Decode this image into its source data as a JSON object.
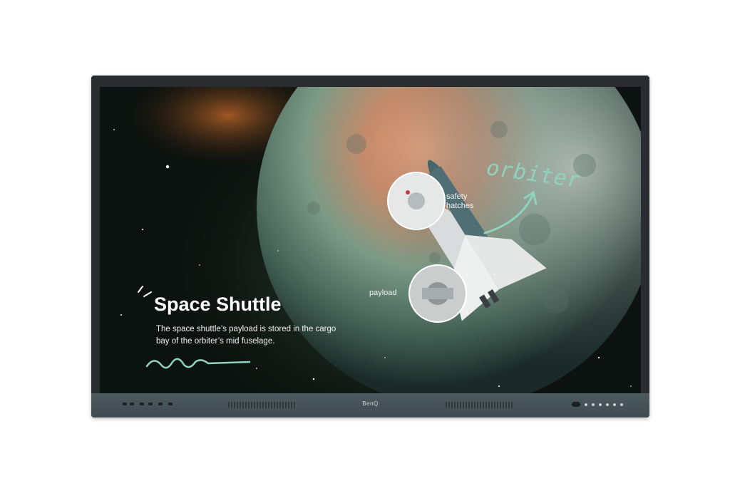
{
  "screen": {
    "title": "Space Shuttle",
    "description": "The space shuttle’s payload is stored in the cargo bay of the orbiter’s mid fuselage.",
    "annotations": {
      "safety_hatches": "safety\nhatches",
      "payload": "payload",
      "orbiter": "orbiter"
    }
  },
  "bezel": {
    "brand": "BenQ"
  },
  "colors": {
    "accent_mint": "#8fd3bf",
    "bezel": "#4d5a60"
  }
}
